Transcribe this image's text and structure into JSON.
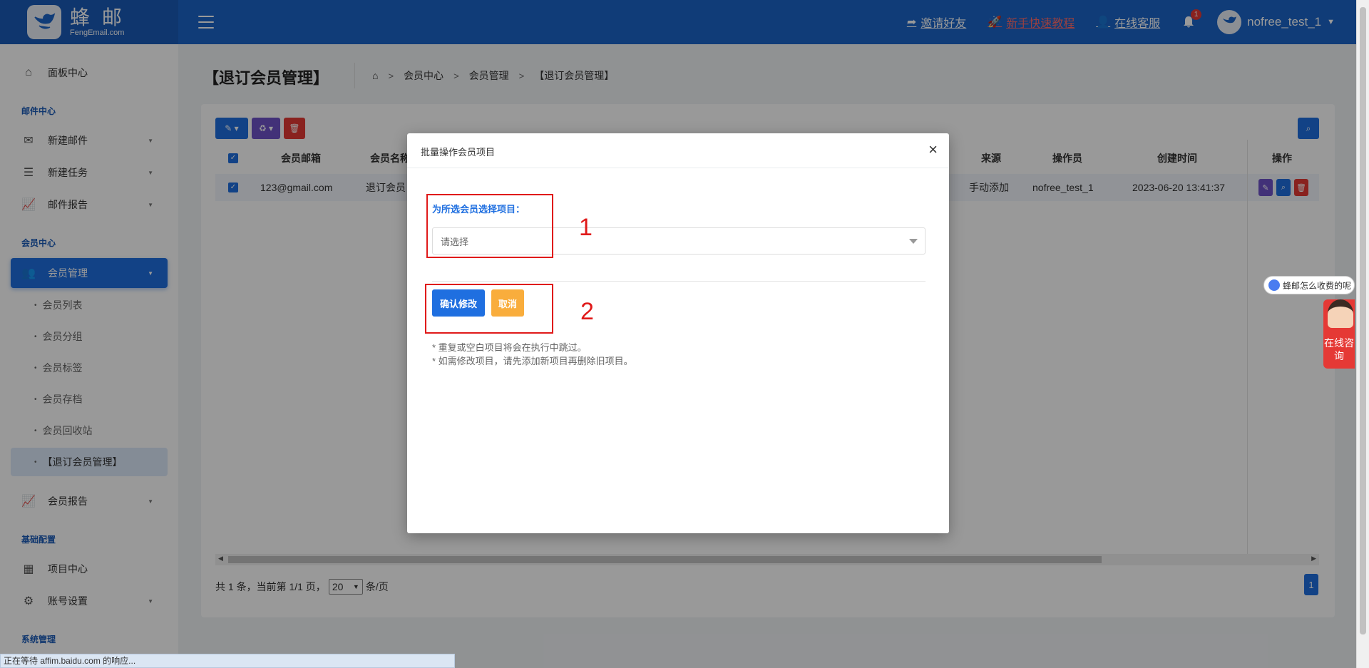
{
  "header": {
    "logo_cn": "蜂 邮",
    "logo_en": "FengEmail.com",
    "invite": "邀请好友",
    "tutorial": "新手快速教程",
    "support": "在线客服",
    "bell_count": "1",
    "username": "nofree_test_1"
  },
  "sidebar": {
    "dashboard": "面板中心",
    "section_mail": "邮件中心",
    "new_mail": "新建邮件",
    "new_task": "新建任务",
    "mail_report": "邮件报告",
    "section_member": "会员中心",
    "member_mgmt": "会员管理",
    "sub_list": "会员列表",
    "sub_group": "会员分组",
    "sub_tag": "会员标签",
    "sub_archive": "会员存档",
    "sub_recycle": "会员回收站",
    "sub_unsub": "【退订会员管理】",
    "member_report": "会员报告",
    "section_base": "基础配置",
    "project_center": "项目中心",
    "account_settings": "账号设置",
    "section_system": "系统管理"
  },
  "page": {
    "title": "【退订会员管理】",
    "breadcrumb": [
      "会员中心",
      "会员管理",
      "【退订会员管理】"
    ]
  },
  "table": {
    "headers": {
      "email": "会员邮箱",
      "name": "会员名称",
      "source": "来源",
      "operator": "操作员",
      "created": "创建时间",
      "actions": "操作"
    },
    "row": {
      "email": "123@gmail.com",
      "name": "退订会员",
      "source": "手动添加",
      "operator": "nofree_test_1",
      "created": "2023-06-20 13:41:37"
    }
  },
  "pager": {
    "summary": "共 1 条，当前第 1/1 页，",
    "page_size": "20",
    "per_page": "条/页",
    "current_page": "1"
  },
  "modal": {
    "title": "批量操作会员项目",
    "label": "为所选会员选择项目：",
    "select_placeholder": "请选择",
    "confirm": "确认修改",
    "cancel": "取消",
    "note1": "* 重复或空白项目将会在执行中跳过。",
    "note2": "* 如需修改项目，请先添加新项目再删除旧项目。"
  },
  "annotations": {
    "num1": "1",
    "num2": "2"
  },
  "chat": {
    "bubble": "蜂邮怎么收费的呢",
    "tab": "在线咨询"
  },
  "status_bar": "正在等待 affim.baidu.com 的响应..."
}
